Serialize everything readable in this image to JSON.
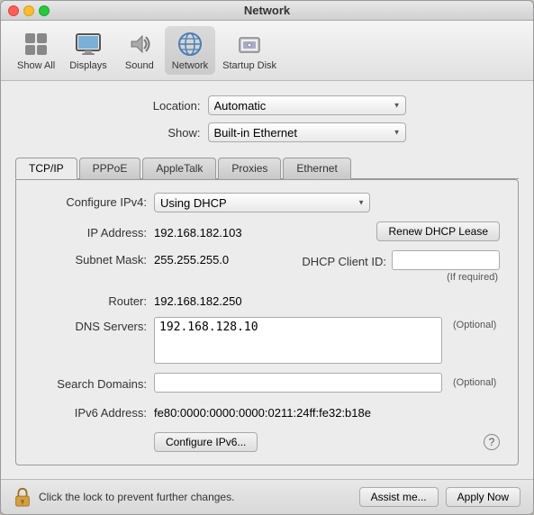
{
  "window": {
    "title": "Network"
  },
  "toolbar": {
    "items": [
      {
        "id": "show-all",
        "label": "Show All"
      },
      {
        "id": "displays",
        "label": "Displays"
      },
      {
        "id": "sound",
        "label": "Sound"
      },
      {
        "id": "network",
        "label": "Network",
        "active": true
      },
      {
        "id": "startup-disk",
        "label": "Startup Disk"
      }
    ]
  },
  "form": {
    "location_label": "Location:",
    "location_value": "Automatic",
    "show_label": "Show:",
    "show_value": "Built-in Ethernet"
  },
  "tabs": [
    {
      "id": "tcpip",
      "label": "TCP/IP",
      "active": true
    },
    {
      "id": "pppoe",
      "label": "PPPoE"
    },
    {
      "id": "appletalk",
      "label": "AppleTalk"
    },
    {
      "id": "proxies",
      "label": "Proxies"
    },
    {
      "id": "ethernet",
      "label": "Ethernet"
    }
  ],
  "panel": {
    "configure_ipv4_label": "Configure IPv4:",
    "configure_ipv4_value": "Using DHCP",
    "ip_address_label": "IP Address:",
    "ip_address_value": "192.168.182.103",
    "renew_dhcp_label": "Renew DHCP Lease",
    "subnet_mask_label": "Subnet Mask:",
    "subnet_mask_value": "255.255.255.0",
    "dhcp_client_label": "DHCP Client ID:",
    "dhcp_client_placeholder": "",
    "dhcp_client_note": "(If required)",
    "router_label": "Router:",
    "router_value": "192.168.182.250",
    "dns_servers_label": "DNS Servers:",
    "dns_servers_value": "192.168.128.10",
    "dns_optional": "(Optional)",
    "search_domains_label": "Search Domains:",
    "search_domains_optional": "(Optional)",
    "ipv6_address_label": "IPv6 Address:",
    "ipv6_address_value": "fe80:0000:0000:0000:0211:24ff:fe32:b18e",
    "configure_ipv6_label": "Configure IPv6...",
    "help_symbol": "?"
  },
  "bottom": {
    "lock_text": "Click the lock to prevent further changes.",
    "assist_label": "Assist me...",
    "apply_label": "Apply Now"
  }
}
